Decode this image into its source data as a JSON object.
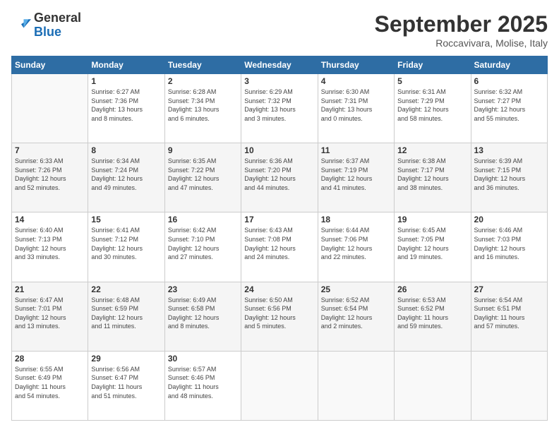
{
  "header": {
    "logo_general": "General",
    "logo_blue": "Blue",
    "month_title": "September 2025",
    "location": "Roccavivara, Molise, Italy"
  },
  "days_of_week": [
    "Sunday",
    "Monday",
    "Tuesday",
    "Wednesday",
    "Thursday",
    "Friday",
    "Saturday"
  ],
  "weeks": [
    [
      {
        "day": "",
        "info": ""
      },
      {
        "day": "1",
        "info": "Sunrise: 6:27 AM\nSunset: 7:36 PM\nDaylight: 13 hours\nand 8 minutes."
      },
      {
        "day": "2",
        "info": "Sunrise: 6:28 AM\nSunset: 7:34 PM\nDaylight: 13 hours\nand 6 minutes."
      },
      {
        "day": "3",
        "info": "Sunrise: 6:29 AM\nSunset: 7:32 PM\nDaylight: 13 hours\nand 3 minutes."
      },
      {
        "day": "4",
        "info": "Sunrise: 6:30 AM\nSunset: 7:31 PM\nDaylight: 13 hours\nand 0 minutes."
      },
      {
        "day": "5",
        "info": "Sunrise: 6:31 AM\nSunset: 7:29 PM\nDaylight: 12 hours\nand 58 minutes."
      },
      {
        "day": "6",
        "info": "Sunrise: 6:32 AM\nSunset: 7:27 PM\nDaylight: 12 hours\nand 55 minutes."
      }
    ],
    [
      {
        "day": "7",
        "info": "Sunrise: 6:33 AM\nSunset: 7:26 PM\nDaylight: 12 hours\nand 52 minutes."
      },
      {
        "day": "8",
        "info": "Sunrise: 6:34 AM\nSunset: 7:24 PM\nDaylight: 12 hours\nand 49 minutes."
      },
      {
        "day": "9",
        "info": "Sunrise: 6:35 AM\nSunset: 7:22 PM\nDaylight: 12 hours\nand 47 minutes."
      },
      {
        "day": "10",
        "info": "Sunrise: 6:36 AM\nSunset: 7:20 PM\nDaylight: 12 hours\nand 44 minutes."
      },
      {
        "day": "11",
        "info": "Sunrise: 6:37 AM\nSunset: 7:19 PM\nDaylight: 12 hours\nand 41 minutes."
      },
      {
        "day": "12",
        "info": "Sunrise: 6:38 AM\nSunset: 7:17 PM\nDaylight: 12 hours\nand 38 minutes."
      },
      {
        "day": "13",
        "info": "Sunrise: 6:39 AM\nSunset: 7:15 PM\nDaylight: 12 hours\nand 36 minutes."
      }
    ],
    [
      {
        "day": "14",
        "info": "Sunrise: 6:40 AM\nSunset: 7:13 PM\nDaylight: 12 hours\nand 33 minutes."
      },
      {
        "day": "15",
        "info": "Sunrise: 6:41 AM\nSunset: 7:12 PM\nDaylight: 12 hours\nand 30 minutes."
      },
      {
        "day": "16",
        "info": "Sunrise: 6:42 AM\nSunset: 7:10 PM\nDaylight: 12 hours\nand 27 minutes."
      },
      {
        "day": "17",
        "info": "Sunrise: 6:43 AM\nSunset: 7:08 PM\nDaylight: 12 hours\nand 24 minutes."
      },
      {
        "day": "18",
        "info": "Sunrise: 6:44 AM\nSunset: 7:06 PM\nDaylight: 12 hours\nand 22 minutes."
      },
      {
        "day": "19",
        "info": "Sunrise: 6:45 AM\nSunset: 7:05 PM\nDaylight: 12 hours\nand 19 minutes."
      },
      {
        "day": "20",
        "info": "Sunrise: 6:46 AM\nSunset: 7:03 PM\nDaylight: 12 hours\nand 16 minutes."
      }
    ],
    [
      {
        "day": "21",
        "info": "Sunrise: 6:47 AM\nSunset: 7:01 PM\nDaylight: 12 hours\nand 13 minutes."
      },
      {
        "day": "22",
        "info": "Sunrise: 6:48 AM\nSunset: 6:59 PM\nDaylight: 12 hours\nand 11 minutes."
      },
      {
        "day": "23",
        "info": "Sunrise: 6:49 AM\nSunset: 6:58 PM\nDaylight: 12 hours\nand 8 minutes."
      },
      {
        "day": "24",
        "info": "Sunrise: 6:50 AM\nSunset: 6:56 PM\nDaylight: 12 hours\nand 5 minutes."
      },
      {
        "day": "25",
        "info": "Sunrise: 6:52 AM\nSunset: 6:54 PM\nDaylight: 12 hours\nand 2 minutes."
      },
      {
        "day": "26",
        "info": "Sunrise: 6:53 AM\nSunset: 6:52 PM\nDaylight: 11 hours\nand 59 minutes."
      },
      {
        "day": "27",
        "info": "Sunrise: 6:54 AM\nSunset: 6:51 PM\nDaylight: 11 hours\nand 57 minutes."
      }
    ],
    [
      {
        "day": "28",
        "info": "Sunrise: 6:55 AM\nSunset: 6:49 PM\nDaylight: 11 hours\nand 54 minutes."
      },
      {
        "day": "29",
        "info": "Sunrise: 6:56 AM\nSunset: 6:47 PM\nDaylight: 11 hours\nand 51 minutes."
      },
      {
        "day": "30",
        "info": "Sunrise: 6:57 AM\nSunset: 6:46 PM\nDaylight: 11 hours\nand 48 minutes."
      },
      {
        "day": "",
        "info": ""
      },
      {
        "day": "",
        "info": ""
      },
      {
        "day": "",
        "info": ""
      },
      {
        "day": "",
        "info": ""
      }
    ]
  ]
}
